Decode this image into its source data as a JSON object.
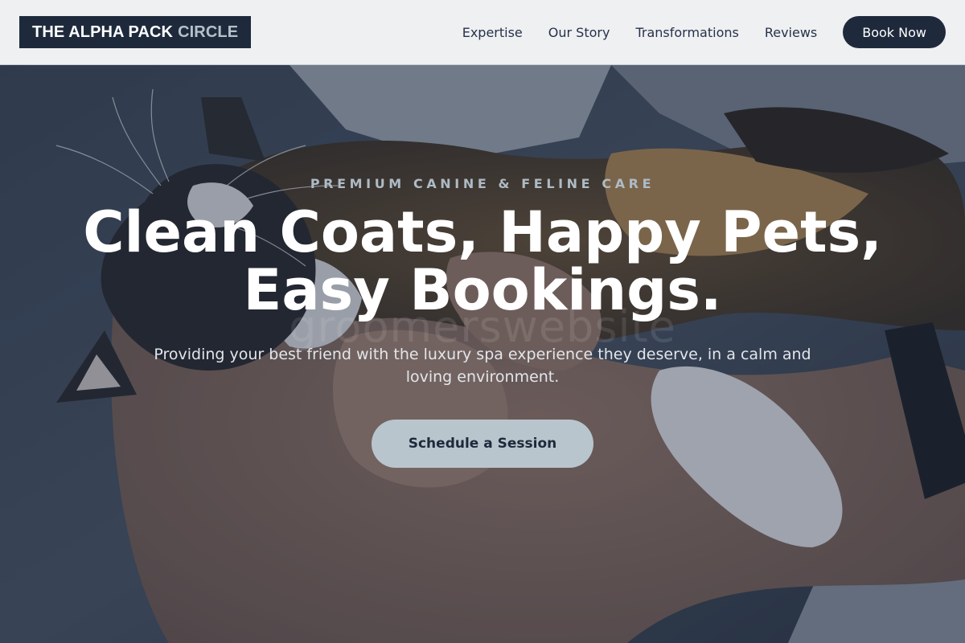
{
  "header": {
    "logo_main": "THE ALPHA PACK",
    "logo_accent": "CIRCLE",
    "nav": [
      {
        "label": "Expertise"
      },
      {
        "label": "Our Story"
      },
      {
        "label": "Transformations"
      },
      {
        "label": "Reviews"
      }
    ],
    "book_label": "Book Now"
  },
  "hero": {
    "eyebrow": "PREMIUM CANINE & FELINE CARE",
    "headline": "Clean Coats, Happy Pets, Easy Bookings.",
    "subtext": "Providing your best friend with the luxury spa experience they deserve, in a calm and loving environment.",
    "cta_label": "Schedule a Session",
    "watermark": "groomerswebsite",
    "image_subject": "calico-cat-held-in-arms-photo"
  },
  "colors": {
    "navy": "#1e2a3c",
    "header_bg": "#eff0f2",
    "accent_gray": "#b5c1c9",
    "cta_bg": "#b9c5cc",
    "eyebrow_text": "#aebbc5"
  }
}
